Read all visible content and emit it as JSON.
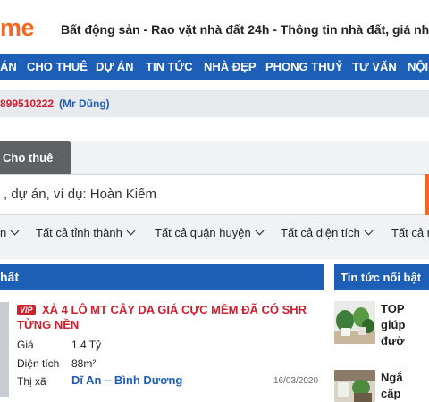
{
  "header": {
    "logo": "me",
    "tagline": "Bất động sản - Rao vặt nhà đất 24h - Thông tin nhà đất, giá nhà"
  },
  "nav": {
    "items": [
      {
        "label": "ÁN"
      },
      {
        "label": "CHO THUÊ"
      },
      {
        "label": "DỰ ÁN"
      },
      {
        "label": "TIN TỨC"
      },
      {
        "label": "NHÀ ĐẸP"
      },
      {
        "label": "PHONG THUỶ"
      },
      {
        "label": "TƯ VẤN"
      },
      {
        "label": "NỘI"
      }
    ]
  },
  "hotline": {
    "number": "899510222",
    "name": "(Mr Dũng)"
  },
  "search": {
    "tab_label": "Cho thuê",
    "placeholder": ", dự án, ví dụ: Hoàn Kiếm",
    "filters": [
      {
        "label": "n"
      },
      {
        "label": "Tất cả tỉnh thành"
      },
      {
        "label": "Tất cả quận huyện"
      },
      {
        "label": "Tất cả diện tích"
      },
      {
        "label": "Tất cả m"
      }
    ]
  },
  "main": {
    "heading": "hất",
    "listing": {
      "badge": "VIP",
      "title": "XẢ 4 LÔ MT CÂY DA GIÁ CỰC MỀM ĐÃ CÓ SHR TỪNG NỀN",
      "price_label": "Giá",
      "price_value": "1.4 Tỷ",
      "area_label": "Diện tích",
      "area_value": "88m²",
      "town_label": "Thị xã",
      "location": "Dĩ An – Bình Dương",
      "date": "16/03/2020"
    }
  },
  "sidebar": {
    "heading": "Tin tức nổi bật",
    "news": [
      {
        "lines": [
          "TOP",
          "giúp",
          "đườ"
        ]
      },
      {
        "lines": [
          "Ngắ",
          "cấp"
        ]
      }
    ]
  },
  "colors": {
    "brand_orange": "#f26722",
    "nav_blue": "#1d5fb7",
    "accent_red": "#d0202e"
  }
}
